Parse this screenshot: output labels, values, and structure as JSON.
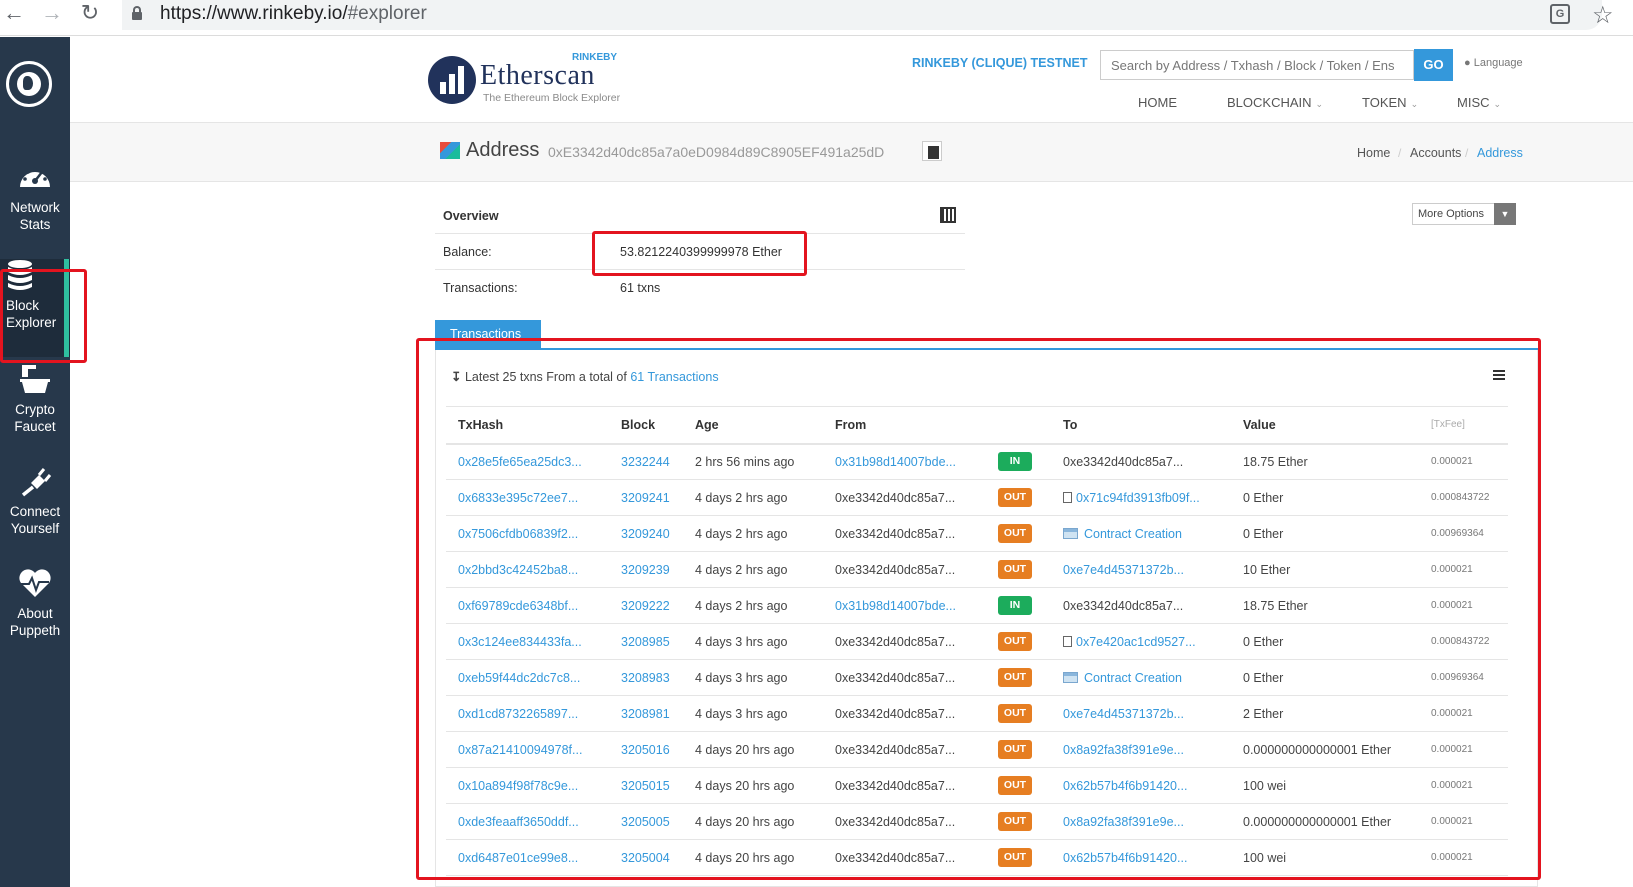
{
  "browser": {
    "url_main": "https://www.rinkeby.io/",
    "url_hash": "#explorer",
    "translate_icon": "translate-icon",
    "star_icon": "star-icon"
  },
  "sidebar": {
    "items": [
      {
        "label": "Network\nStats",
        "icon": "dashboard-icon"
      },
      {
        "label": "Block\nExplorer",
        "icon": "database-icon"
      },
      {
        "label": "Crypto\nFaucet",
        "icon": "faucet-icon"
      },
      {
        "label": "Connect\nYourself",
        "icon": "plug-icon"
      },
      {
        "label": "About\nPuppeth",
        "icon": "heartbeat-icon"
      }
    ]
  },
  "header": {
    "logo_word": "Etherscan",
    "logo_tag": "The Ethereum Block Explorer",
    "logo_badge": "RINKEBY",
    "testnet": "RINKEBY (CLIQUE) TESTNET",
    "search_placeholder": "Search by Address / Txhash / Block / Token / Ens",
    "go": "GO",
    "language": "Language",
    "nav": [
      "HOME",
      "BLOCKCHAIN",
      "TOKEN",
      "MISC"
    ]
  },
  "address": {
    "title": "Address",
    "hash": "0xE3342d40dc85a7a0eD0984d89C8905EF491a25dD",
    "breadcrumb": [
      "Home",
      "Accounts",
      "Address"
    ]
  },
  "overview": {
    "heading": "Overview",
    "balance_label": "Balance:",
    "balance_value": "53.8212240399999978 Ether",
    "tx_label": "Transactions:",
    "tx_value": "61 txns",
    "more_options": "More Options"
  },
  "transactions": {
    "tab": "Transactions",
    "latest_prefix": "Latest 25 txns From a total of",
    "latest_link": "61 Transactions",
    "columns": [
      "TxHash",
      "Block",
      "Age",
      "From",
      "",
      "To",
      "Value",
      "[TxFee]"
    ],
    "rows": [
      {
        "hash": "0x28e5fe65ea25dc3...",
        "block": "3232244",
        "age": "2 hrs 56 mins ago",
        "from": "0x31b98d14007bde...",
        "from_link": true,
        "dir": "IN",
        "to": "0xe3342d40dc85a7...",
        "to_link": false,
        "to_icon": "",
        "value": "18.75 Ether",
        "fee": "0.000021"
      },
      {
        "hash": "0x6833e395c72ee7...",
        "block": "3209241",
        "age": "4 days 2 hrs ago",
        "from": "0xe3342d40dc85a7...",
        "from_link": false,
        "dir": "OUT",
        "to": "0x71c94fd3913fb09f...",
        "to_link": true,
        "to_icon": "doc",
        "value": "0 Ether",
        "fee": "0.000843722"
      },
      {
        "hash": "0x7506cfdb06839f2...",
        "block": "3209240",
        "age": "4 days 2 hrs ago",
        "from": "0xe3342d40dc85a7...",
        "from_link": false,
        "dir": "OUT",
        "to": "Contract Creation",
        "to_link": true,
        "to_icon": "contract",
        "value": "0 Ether",
        "fee": "0.00969364"
      },
      {
        "hash": "0x2bbd3c42452ba8...",
        "block": "3209239",
        "age": "4 days 2 hrs ago",
        "from": "0xe3342d40dc85a7...",
        "from_link": false,
        "dir": "OUT",
        "to": "0xe7e4d45371372b...",
        "to_link": true,
        "to_icon": "",
        "value": "10 Ether",
        "fee": "0.000021"
      },
      {
        "hash": "0xf69789cde6348bf...",
        "block": "3209222",
        "age": "4 days 2 hrs ago",
        "from": "0x31b98d14007bde...",
        "from_link": true,
        "dir": "IN",
        "to": "0xe3342d40dc85a7...",
        "to_link": false,
        "to_icon": "",
        "value": "18.75 Ether",
        "fee": "0.000021"
      },
      {
        "hash": "0x3c124ee834433fa...",
        "block": "3208985",
        "age": "4 days 3 hrs ago",
        "from": "0xe3342d40dc85a7...",
        "from_link": false,
        "dir": "OUT",
        "to": "0x7e420ac1cd9527...",
        "to_link": true,
        "to_icon": "doc",
        "value": "0 Ether",
        "fee": "0.000843722"
      },
      {
        "hash": "0xeb59f44dc2dc7c8...",
        "block": "3208983",
        "age": "4 days 3 hrs ago",
        "from": "0xe3342d40dc85a7...",
        "from_link": false,
        "dir": "OUT",
        "to": "Contract Creation",
        "to_link": true,
        "to_icon": "contract",
        "value": "0 Ether",
        "fee": "0.00969364"
      },
      {
        "hash": "0xd1cd8732265897...",
        "block": "3208981",
        "age": "4 days 3 hrs ago",
        "from": "0xe3342d40dc85a7...",
        "from_link": false,
        "dir": "OUT",
        "to": "0xe7e4d45371372b...",
        "to_link": true,
        "to_icon": "",
        "value": "2 Ether",
        "fee": "0.000021"
      },
      {
        "hash": "0x87a21410094978f...",
        "block": "3205016",
        "age": "4 days 20 hrs ago",
        "from": "0xe3342d40dc85a7...",
        "from_link": false,
        "dir": "OUT",
        "to": "0x8a92fa38f391e9e...",
        "to_link": true,
        "to_icon": "",
        "value": "0.000000000000001 Ether",
        "fee": "0.000021"
      },
      {
        "hash": "0x10a894f98f78c9e...",
        "block": "3205015",
        "age": "4 days 20 hrs ago",
        "from": "0xe3342d40dc85a7...",
        "from_link": false,
        "dir": "OUT",
        "to": "0x62b57b4f6b91420...",
        "to_link": true,
        "to_icon": "",
        "value": "100 wei",
        "fee": "0.000021"
      },
      {
        "hash": "0xde3feaaff3650ddf...",
        "block": "3205005",
        "age": "4 days 20 hrs ago",
        "from": "0xe3342d40dc85a7...",
        "from_link": false,
        "dir": "OUT",
        "to": "0x8a92fa38f391e9e...",
        "to_link": true,
        "to_icon": "",
        "value": "0.000000000000001 Ether",
        "fee": "0.000021"
      },
      {
        "hash": "0xd6487e01ce99e8...",
        "block": "3205004",
        "age": "4 days 20 hrs ago",
        "from": "0xe3342d40dc85a7...",
        "from_link": false,
        "dir": "OUT",
        "to": "0x62b57b4f6b91420...",
        "to_link": true,
        "to_icon": "",
        "value": "100 wei",
        "fee": "0.000021"
      }
    ]
  },
  "colors": {
    "sidebar_bg": "#27384b",
    "accent_blue": "#3498db",
    "in_badge": "#1cac5c",
    "out_badge": "#e67e22",
    "annotation_red": "#e3141f"
  }
}
